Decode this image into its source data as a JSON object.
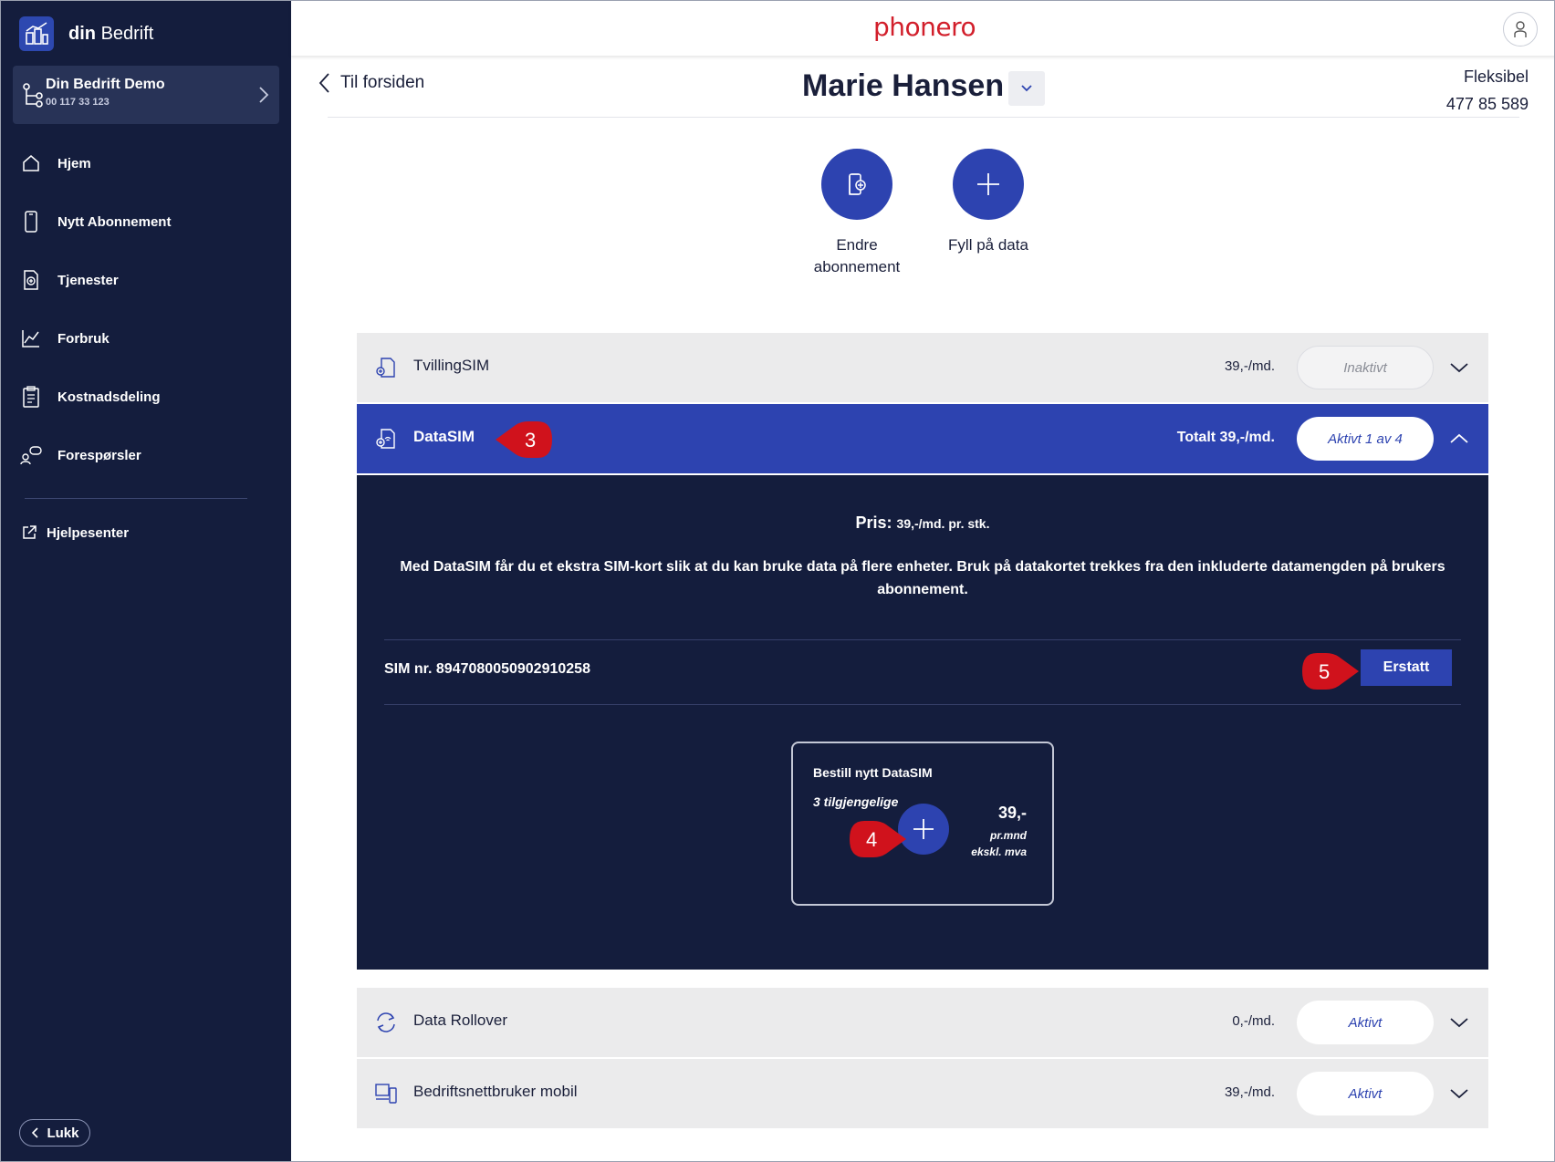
{
  "sidebar": {
    "brand_prefix": "din",
    "brand_suffix": "Bedrift",
    "company_name": "Din Bedrift Demo",
    "company_number": "00 117 33 123",
    "items": [
      {
        "label": "Hjem",
        "icon": "home-icon"
      },
      {
        "label": "Nytt Abonnement",
        "icon": "phone-icon"
      },
      {
        "label": "Tjenester",
        "icon": "services-icon"
      },
      {
        "label": "Forbruk",
        "icon": "usage-chart-icon"
      },
      {
        "label": "Kostnadsdeling",
        "icon": "clipboard-icon"
      },
      {
        "label": "Forespørsler",
        "icon": "requests-icon"
      }
    ],
    "help_label": "Hjelpesenter",
    "close_label": "Lukk"
  },
  "header": {
    "logo": "phonero",
    "back_label": "Til forsiden",
    "user_name": "Marie Hansen",
    "plan_name": "Fleksibel",
    "phone_number": "477 85 589"
  },
  "actions": {
    "change_label_line1": "Endre",
    "change_label_line2": "abonnement",
    "refill_label": "Fyll på data"
  },
  "services": {
    "tvilling": {
      "name": "TvillingSIM",
      "price": "39,-/md.",
      "status": "Inaktivt"
    },
    "datasim": {
      "name": "DataSIM",
      "price": "Totalt 39,-/md.",
      "status": "Aktivt 1 av 4"
    },
    "rollover": {
      "name": "Data Rollover",
      "price": "0,-/md.",
      "status": "Aktivt"
    },
    "bedriftsnett": {
      "name": "Bedriftsnettbruker mobil",
      "price": "39,-/md.",
      "status": "Aktivt"
    }
  },
  "datasim_panel": {
    "price_label": "Pris:",
    "price_value": "39,-/md. pr. stk.",
    "description": "Med DataSIM får du et ekstra SIM-kort slik at du kan bruke data på flere enheter. Bruk på datakortet trekkes fra den inkluderte datamengden på brukers abonnement.",
    "sim_number": "SIM nr. 8947080050902910258",
    "replace_label": "Erstatt",
    "order": {
      "title": "Bestill nytt DataSIM",
      "available": "3 tilgjengelige",
      "price": "39,-",
      "unit_line1": "pr.mnd",
      "unit_line2": "ekskl. mva"
    }
  },
  "markers": {
    "m3": "3",
    "m4": "4",
    "m5": "5"
  },
  "colors": {
    "sidebar": "#141d3d",
    "accent": "#2d43b0",
    "brand_red": "#d21f2b",
    "marker": "#d0121c"
  }
}
